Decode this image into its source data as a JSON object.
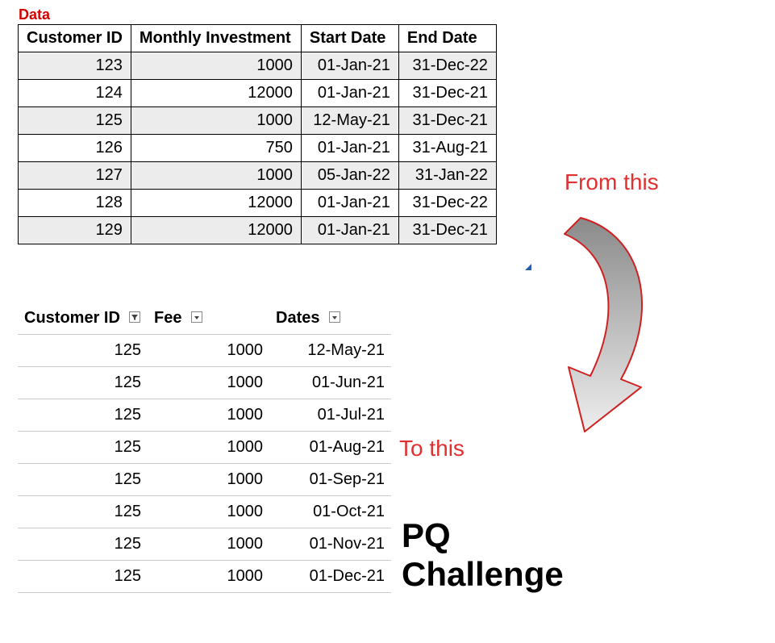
{
  "source_label": "Data",
  "annotations": {
    "from": "From this",
    "to": "To this",
    "title_line1": "PQ",
    "title_line2": "Challenge"
  },
  "table1": {
    "headers": [
      "Customer ID",
      "Monthly Investment",
      "Start Date",
      "End Date"
    ],
    "rows": [
      {
        "customer_id": "123",
        "investment": "1000",
        "start": "01-Jan-21",
        "end": "31-Dec-22"
      },
      {
        "customer_id": "124",
        "investment": "12000",
        "start": "01-Jan-21",
        "end": "31-Dec-21"
      },
      {
        "customer_id": "125",
        "investment": "1000",
        "start": "12-May-21",
        "end": "31-Dec-21"
      },
      {
        "customer_id": "126",
        "investment": "750",
        "start": "01-Jan-21",
        "end": "31-Aug-21"
      },
      {
        "customer_id": "127",
        "investment": "1000",
        "start": "05-Jan-22",
        "end": "31-Jan-22"
      },
      {
        "customer_id": "128",
        "investment": "12000",
        "start": "01-Jan-21",
        "end": "31-Dec-22"
      },
      {
        "customer_id": "129",
        "investment": "12000",
        "start": "01-Jan-21",
        "end": "31-Dec-21"
      }
    ]
  },
  "table2": {
    "headers": [
      "Customer ID",
      "Fee",
      "Dates"
    ],
    "rows": [
      {
        "customer_id": "125",
        "fee": "1000",
        "date": "12-May-21"
      },
      {
        "customer_id": "125",
        "fee": "1000",
        "date": "01-Jun-21"
      },
      {
        "customer_id": "125",
        "fee": "1000",
        "date": "01-Jul-21"
      },
      {
        "customer_id": "125",
        "fee": "1000",
        "date": "01-Aug-21"
      },
      {
        "customer_id": "125",
        "fee": "1000",
        "date": "01-Sep-21"
      },
      {
        "customer_id": "125",
        "fee": "1000",
        "date": "01-Oct-21"
      },
      {
        "customer_id": "125",
        "fee": "1000",
        "date": "01-Nov-21"
      },
      {
        "customer_id": "125",
        "fee": "1000",
        "date": "01-Dec-21"
      }
    ]
  },
  "chart_data": {
    "type": "table",
    "source": {
      "columns": [
        "Customer ID",
        "Monthly Investment",
        "Start Date",
        "End Date"
      ],
      "rows": [
        [
          123,
          1000,
          "01-Jan-21",
          "31-Dec-22"
        ],
        [
          124,
          12000,
          "01-Jan-21",
          "31-Dec-21"
        ],
        [
          125,
          1000,
          "12-May-21",
          "31-Dec-21"
        ],
        [
          126,
          750,
          "01-Jan-21",
          "31-Aug-21"
        ],
        [
          127,
          1000,
          "05-Jan-22",
          "31-Jan-22"
        ],
        [
          128,
          12000,
          "01-Jan-21",
          "31-Dec-22"
        ],
        [
          129,
          12000,
          "01-Jan-21",
          "31-Dec-21"
        ]
      ]
    },
    "result": {
      "columns": [
        "Customer ID",
        "Fee",
        "Dates"
      ],
      "rows": [
        [
          125,
          1000,
          "12-May-21"
        ],
        [
          125,
          1000,
          "01-Jun-21"
        ],
        [
          125,
          1000,
          "01-Jul-21"
        ],
        [
          125,
          1000,
          "01-Aug-21"
        ],
        [
          125,
          1000,
          "01-Sep-21"
        ],
        [
          125,
          1000,
          "01-Oct-21"
        ],
        [
          125,
          1000,
          "01-Nov-21"
        ],
        [
          125,
          1000,
          "01-Dec-21"
        ]
      ]
    }
  }
}
